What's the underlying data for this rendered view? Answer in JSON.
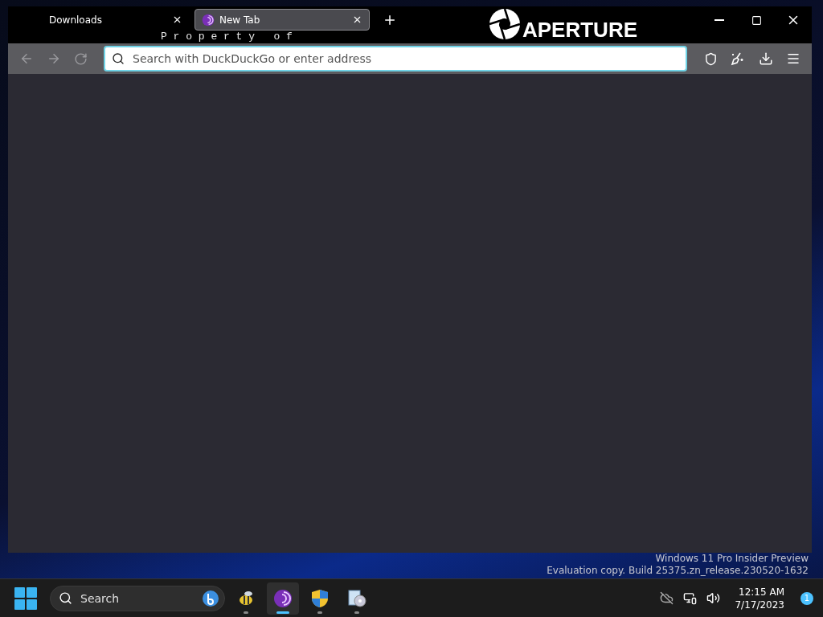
{
  "tabs": [
    {
      "title": "Downloads",
      "selected": false
    },
    {
      "title": "New Tab",
      "selected": true
    }
  ],
  "address_bar": {
    "placeholder": "Search with DuckDuckGo or enter address"
  },
  "wallpaper": {
    "tagline": "P r o p e r t y   o f",
    "logo": "APERTURE",
    "watermark_lines": [
      "Windows 11 Pro Insider Preview",
      "Evaluation copy. Build 25375.zn_release.230520-1632"
    ]
  },
  "taskbar": {
    "search_placeholder": "Search",
    "apps": [
      {
        "kind": "bee",
        "selected": false
      },
      {
        "kind": "browser",
        "selected": true
      },
      {
        "kind": "shield",
        "selected": false
      },
      {
        "kind": "installer",
        "selected": false
      }
    ],
    "time": "12:15 AM",
    "date": "7/17/2023",
    "notification_count": "1"
  }
}
